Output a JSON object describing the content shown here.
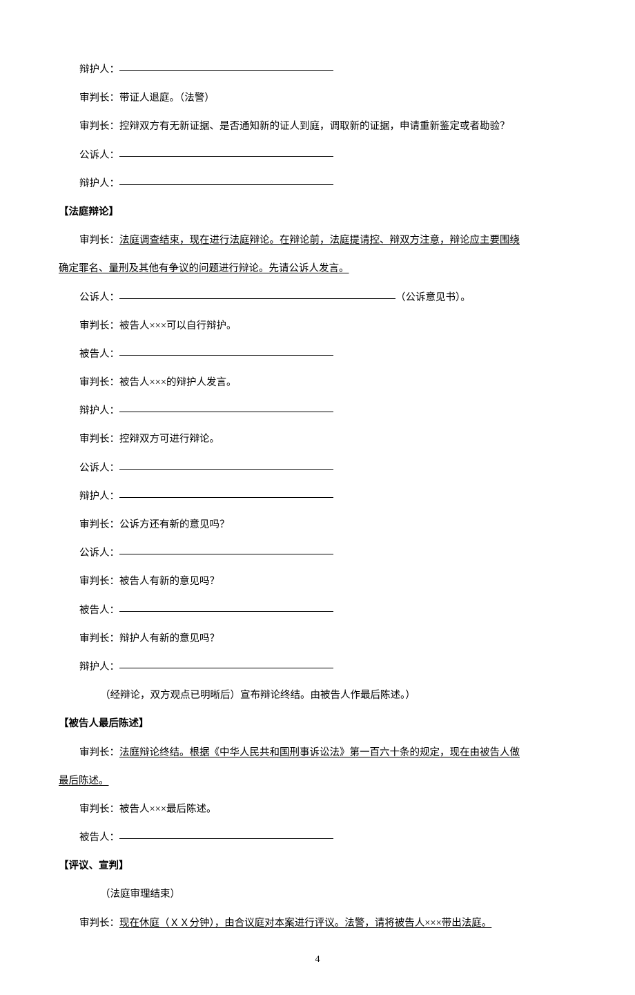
{
  "lines": {
    "l1": "辩护人：",
    "l2": "审判长：带证人退庭。（法警）",
    "l3": "审判长：控辩双方有无新证据、是否通知新的证人到庭，调取新的证据，申请重新鉴定或者勘验？",
    "l4": "公诉人：",
    "l5": "辩护人："
  },
  "section1": {
    "title": "【法庭辩论】",
    "s1_part1": "审判长：",
    "s1_underlined1": "法庭调查结束，现在进行法庭辩论。在辩论前，法庭提请控、辩双方注意，辩论应主要围绕",
    "s1_underlined2": "确定罪名、量刑及其他有争议的问题进行辩论。先请公诉人发言。",
    "s2": "公诉人：",
    "s2_suffix": "（公诉意见书）。",
    "s3": "审判长：被告人×××可以自行辩护。",
    "s4": "被告人：",
    "s5": "审判长：被告人×××的辩护人发言。",
    "s6": "辩护人：",
    "s7": "审判长：控辩双方可进行辩论。",
    "s8": "公诉人：",
    "s9": "辩护人：",
    "s10": "审判长：公诉方还有新的意见吗？",
    "s11": "公诉人：",
    "s12": "审判长：被告人有新的意见吗？",
    "s13": "被告人：",
    "s14": "审判长：辩护人有新的意见吗？",
    "s15": "辩护人：",
    "s16": "（经辩论，双方观点已明晰后）宣布辩论终结。由被告人作最后陈述。）"
  },
  "section2": {
    "title": "【被告人最后陈述】",
    "s1_part1": "审判长：",
    "s1_underlined1": "法庭辩论终结。根据《中华人民共和国刑事诉讼法》第一百六十条的规定，现在由被告人做",
    "s1_underlined2": "最后陈述。",
    "s2": "审判长：被告人×××最后陈述。",
    "s3": "被告人："
  },
  "section3": {
    "title": "【评议、宣判】",
    "s1": "（法庭审理结束）",
    "s2_part1": "审判长：",
    "s2_underlined": "现在休庭（ＸＸ分钟），由合议庭对本案进行评议。法警，请将被告人×××带出法庭。"
  },
  "pageNumber": "4"
}
